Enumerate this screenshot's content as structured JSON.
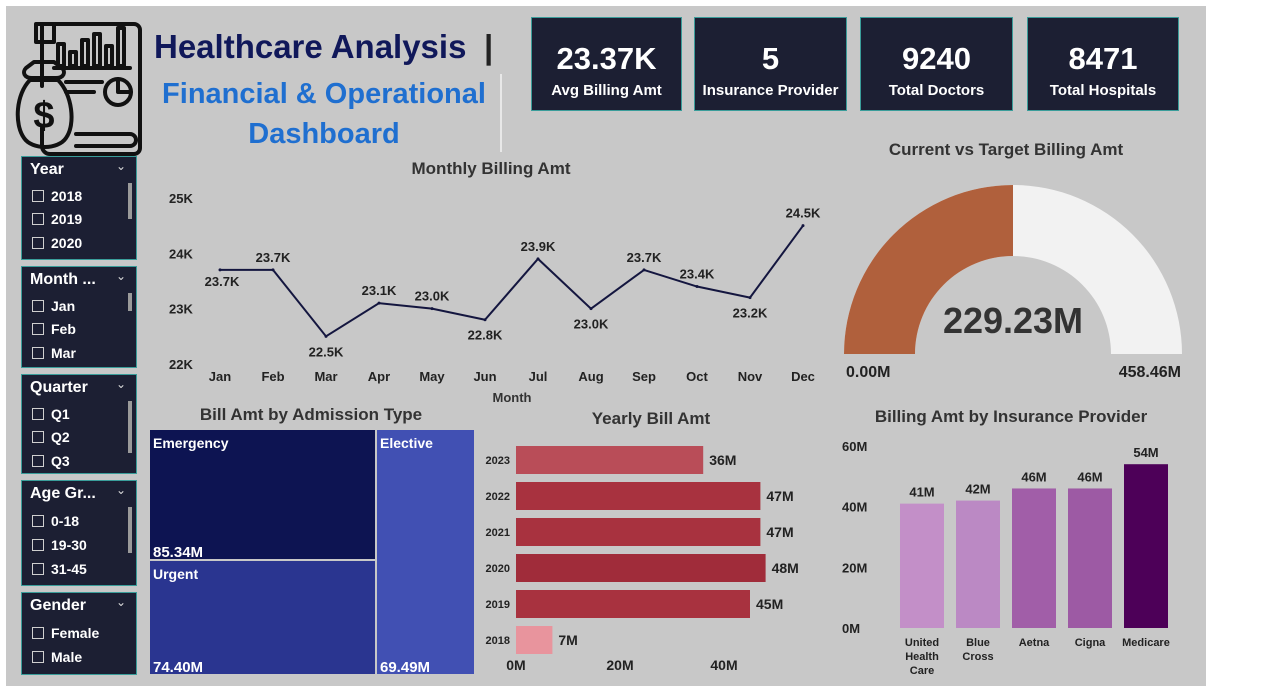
{
  "header": {
    "title_main": "Healthcare Analysis",
    "title_sep": "|",
    "title_sub": "Financial & Operational Dashboard"
  },
  "kpis": [
    {
      "value": "23.37K",
      "label": "Avg Billing Amt"
    },
    {
      "value": "5",
      "label": "Insurance Provider"
    },
    {
      "value": "9240",
      "label": "Total Doctors"
    },
    {
      "value": "8471",
      "label": "Total Hospitals"
    }
  ],
  "slicers": {
    "year": {
      "title": "Year",
      "options": [
        "2018",
        "2019",
        "2020"
      ]
    },
    "month": {
      "title": "Month ...",
      "options": [
        "Jan",
        "Feb",
        "Mar"
      ]
    },
    "quarter": {
      "title": "Quarter",
      "options": [
        "Q1",
        "Q2",
        "Q3"
      ]
    },
    "age": {
      "title": "Age Gr...",
      "options": [
        "0-18",
        "19-30",
        "31-45"
      ]
    },
    "gender": {
      "title": "Gender",
      "options": [
        "Female",
        "Male"
      ]
    }
  },
  "chart_data": [
    {
      "type": "line",
      "title": "Monthly Billing Amt",
      "xlabel": "Month",
      "ylabel": "",
      "categories": [
        "Jan",
        "Feb",
        "Mar",
        "Apr",
        "May",
        "Jun",
        "Jul",
        "Aug",
        "Sep",
        "Oct",
        "Nov",
        "Dec"
      ],
      "values": [
        23.7,
        23.7,
        22.5,
        23.1,
        23.0,
        22.8,
        23.9,
        23.0,
        23.7,
        23.4,
        23.2,
        24.5
      ],
      "value_labels": [
        "23.7K",
        "23.7K",
        "22.5K",
        "23.1K",
        "23.0K",
        "22.8K",
        "23.9K",
        "23.0K",
        "23.7K",
        "23.4K",
        "23.2K",
        "24.5K"
      ],
      "yticks": [
        "22K",
        "23K",
        "24K",
        "25K"
      ],
      "ylim": [
        22,
        25
      ],
      "color": "#14163f"
    },
    {
      "type": "gauge",
      "title": "Current vs Target Billing Amt",
      "value": 229.23,
      "value_label": "229.23M",
      "min_label": "0.00M",
      "max_label": "458.46M",
      "max": 458.46,
      "fill_color": "#b0603c",
      "track_color": "#f2f2f2"
    },
    {
      "type": "treemap",
      "title": "Bill Amt by Admission Type",
      "items": [
        {
          "name": "Emergency",
          "value": 85.34,
          "label": "85.34M",
          "color": "#0d1452"
        },
        {
          "name": "Urgent",
          "value": 74.4,
          "label": "74.40M",
          "color": "#2a3590"
        },
        {
          "name": "Elective",
          "value": 69.49,
          "label": "69.49M",
          "color": "#4150b3"
        }
      ]
    },
    {
      "type": "bar",
      "orientation": "horizontal",
      "title": "Yearly Bill Amt",
      "categories": [
        "2023",
        "2022",
        "2021",
        "2020",
        "2019",
        "2018"
      ],
      "values": [
        36,
        47,
        47,
        48,
        45,
        7
      ],
      "value_labels": [
        "36M",
        "47M",
        "47M",
        "48M",
        "45M",
        "7M"
      ],
      "colors": [
        "#b94d58",
        "#a8323f",
        "#a8323f",
        "#a02c3a",
        "#a8323f",
        "#e8949d"
      ],
      "xticks": [
        "0M",
        "20M",
        "40M"
      ],
      "xlim": [
        0,
        50
      ]
    },
    {
      "type": "bar",
      "title": "Billing Amt by Insurance Provider",
      "categories": [
        "United Health Care",
        "Blue Cross",
        "Aetna",
        "Cigna",
        "Medicare"
      ],
      "category_lines": [
        [
          "United",
          "Health",
          "Care"
        ],
        [
          "Blue",
          "Cross"
        ],
        [
          "Aetna"
        ],
        [
          "Cigna"
        ],
        [
          "Medicare"
        ]
      ],
      "values": [
        41,
        42,
        46,
        46,
        54
      ],
      "value_labels": [
        "41M",
        "42M",
        "46M",
        "46M",
        "54M"
      ],
      "colors": [
        "#c38fc8",
        "#bb89c4",
        "#a15ea8",
        "#9d5aa4",
        "#4d0058"
      ],
      "yticks": [
        "0M",
        "20M",
        "40M",
        "60M"
      ],
      "ylim": [
        0,
        60
      ]
    }
  ]
}
